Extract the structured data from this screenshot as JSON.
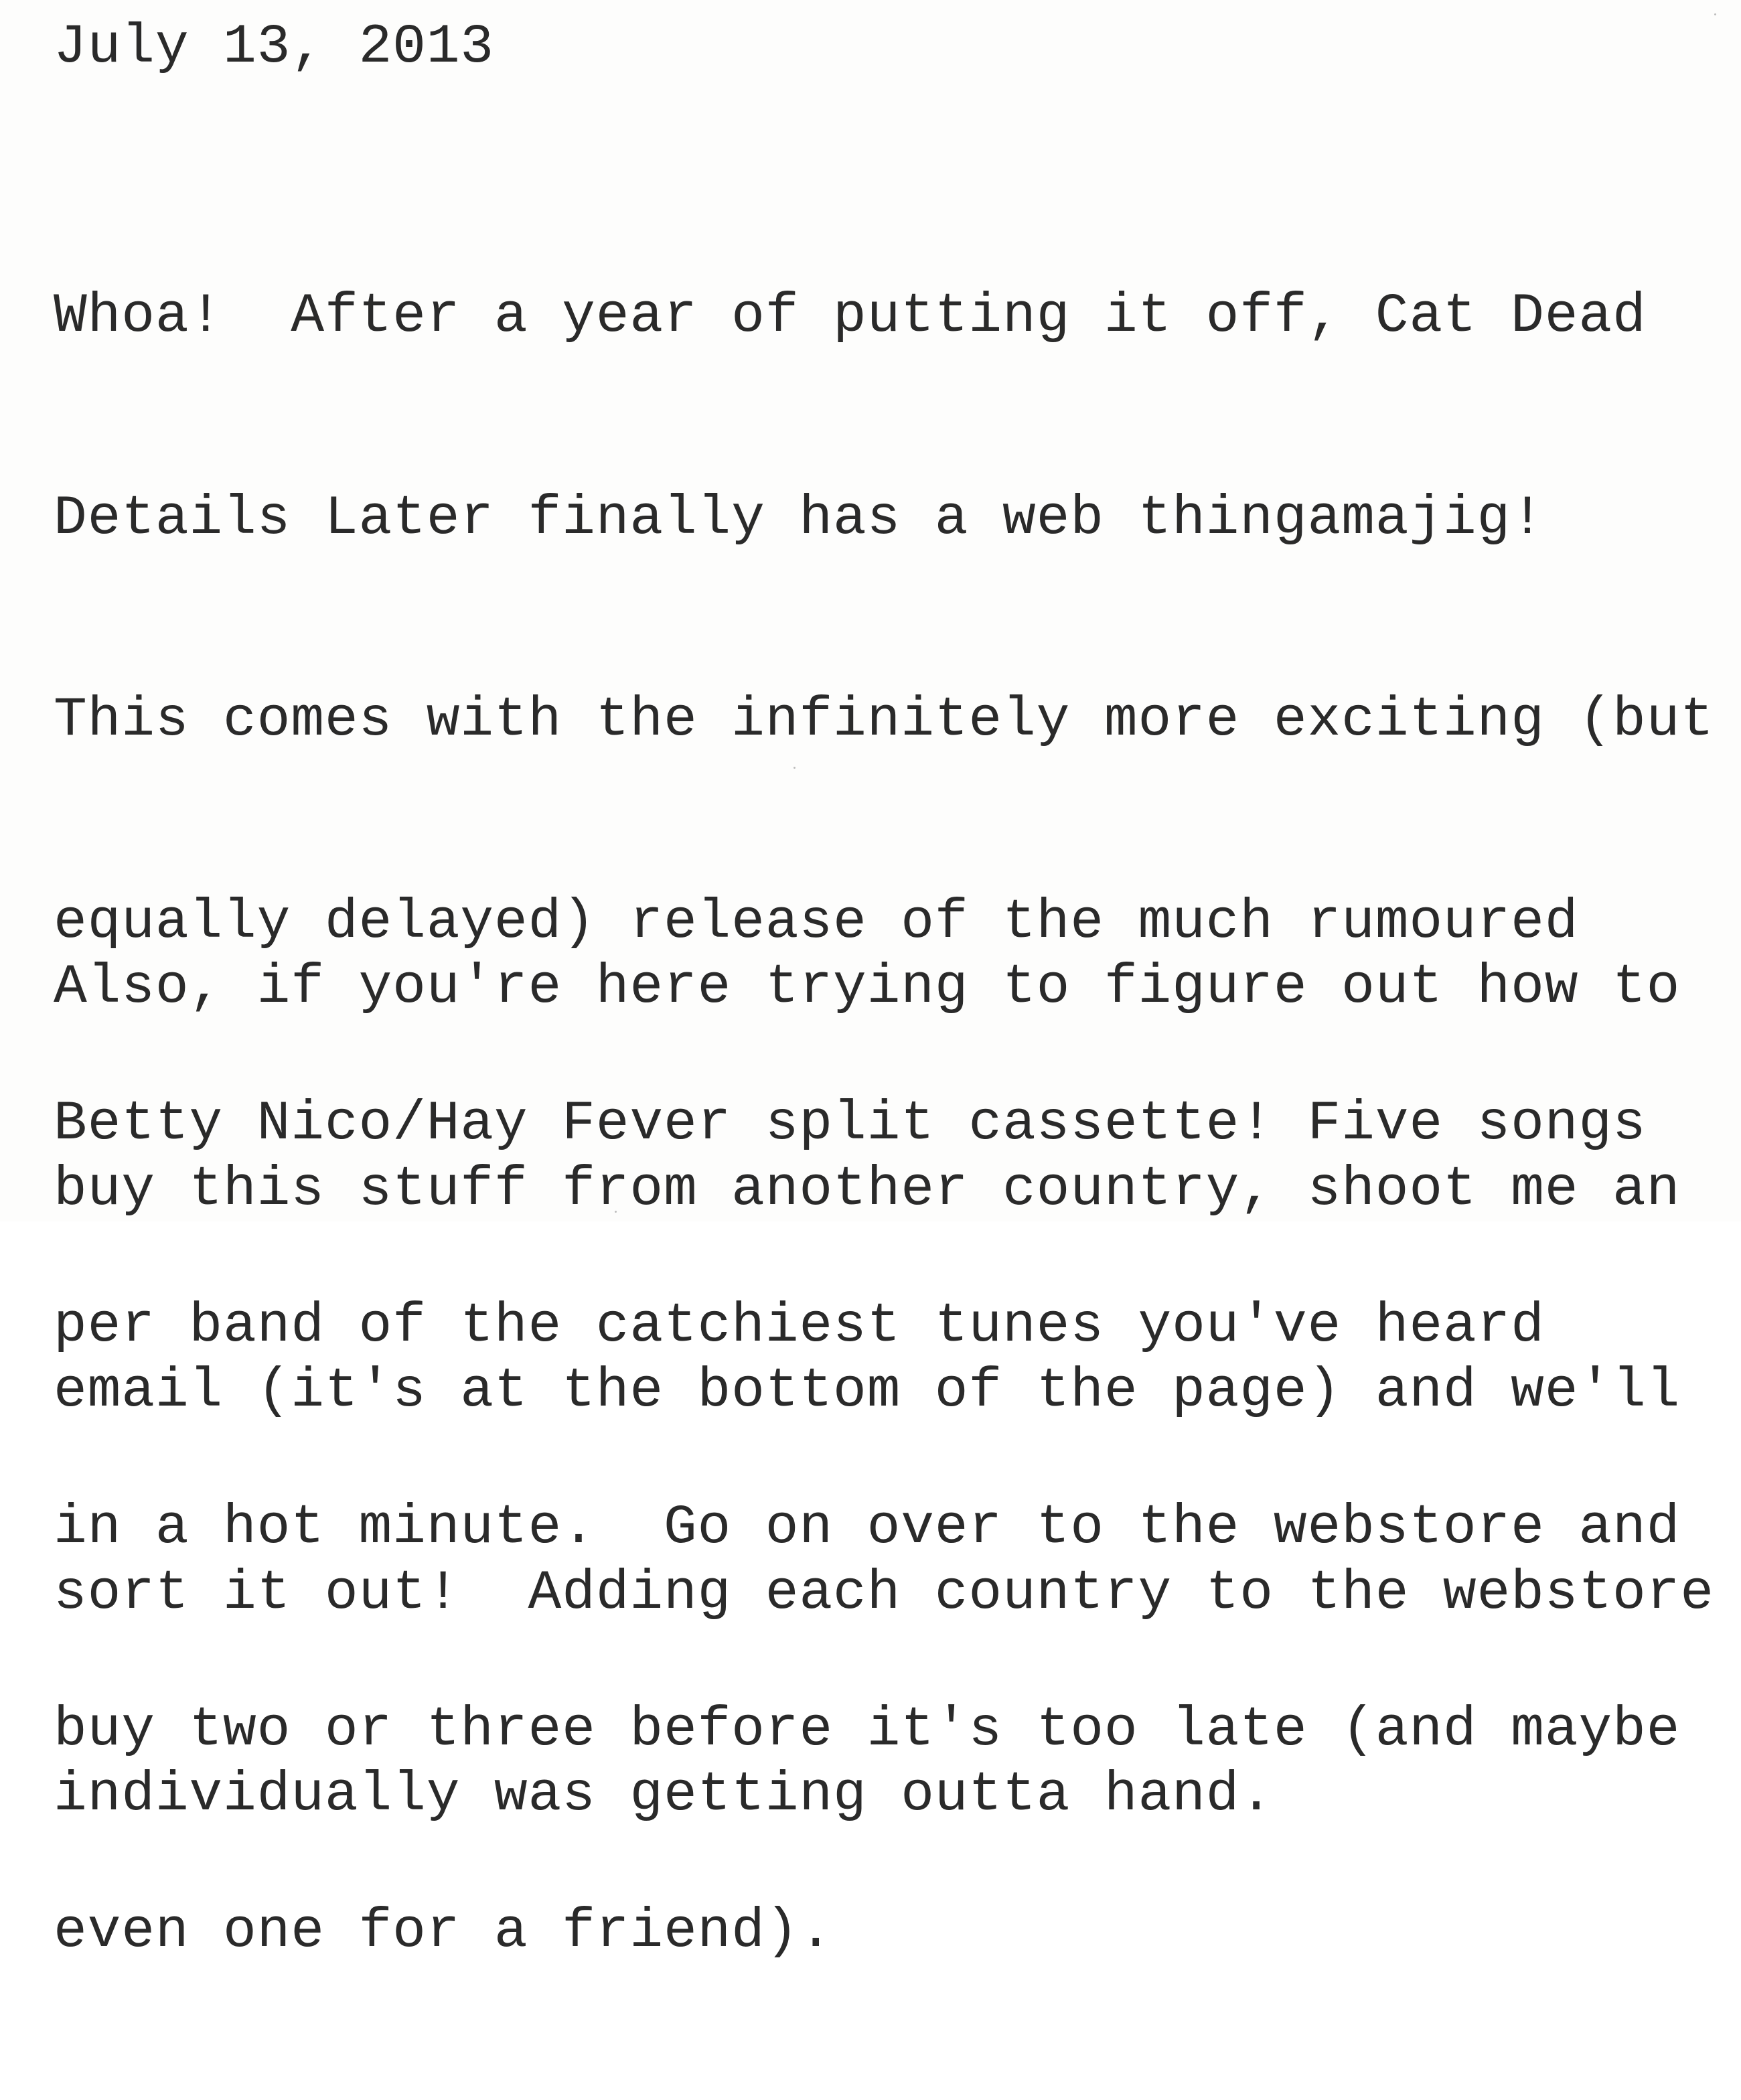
{
  "document": {
    "date": "July 13, 2013",
    "paragraphs": [
      {
        "lines": [
          "Whoa!  After a year of putting it off, Cat Dead",
          "Details Later finally has a web thingamajig!",
          "This comes with the infinitely more exciting (but",
          "equally delayed) release of the much rumoured",
          "Betty Nico/Hay Fever split cassette! Five songs",
          "per band of the catchiest tunes you've heard",
          "in a hot minute.  Go on over to the webstore and",
          "buy two or three before it's too late (and maybe",
          "even one for a friend)."
        ]
      },
      {
        "lines": [
          "Also, if you're here trying to figure out how to",
          "buy this stuff from another country, shoot me an",
          "email (it's at the bottom of the page) and we'll",
          "sort it out!  Adding each country to the webstore",
          "individually was getting outta hand."
        ]
      }
    ]
  }
}
